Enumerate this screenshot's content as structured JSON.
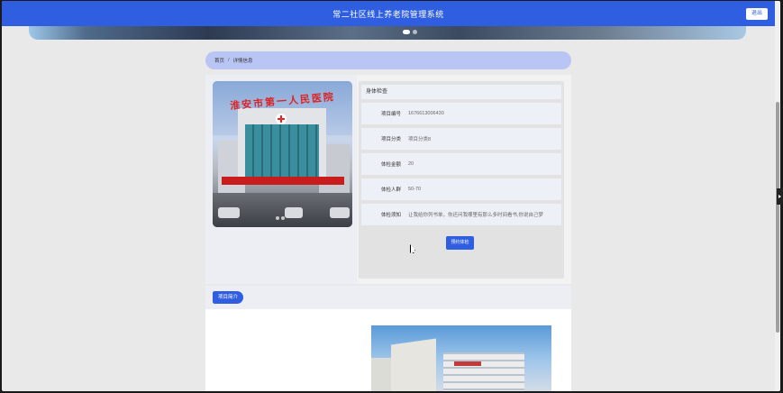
{
  "header": {
    "title": "常二社区线上养老院管理系统",
    "logout_label": "退出"
  },
  "breadcrumb": {
    "home": "首页",
    "separator": "/",
    "current": "详情信息"
  },
  "detail": {
    "section_title": "身体检查",
    "fields": [
      {
        "label": "项目编号",
        "value": "1676613006430"
      },
      {
        "label": "项目分类",
        "value": "项目分类8"
      },
      {
        "label": "体检金额",
        "value": "20"
      },
      {
        "label": "体检人群",
        "value": "50-70"
      },
      {
        "label": "体检须知",
        "value": "让我给你列书单，你还问我哪里有那么多时间看书,你说自己梦"
      }
    ],
    "book_button_label": "预约体检"
  },
  "photo": {
    "sign_text": "淮安市第一人民医院"
  },
  "intro": {
    "tag_label": "项目简介"
  },
  "colors": {
    "primary": "#2f5fe0",
    "breadcrumb_bg": "#b9c6f5",
    "page_bg": "#e9e9e9"
  }
}
